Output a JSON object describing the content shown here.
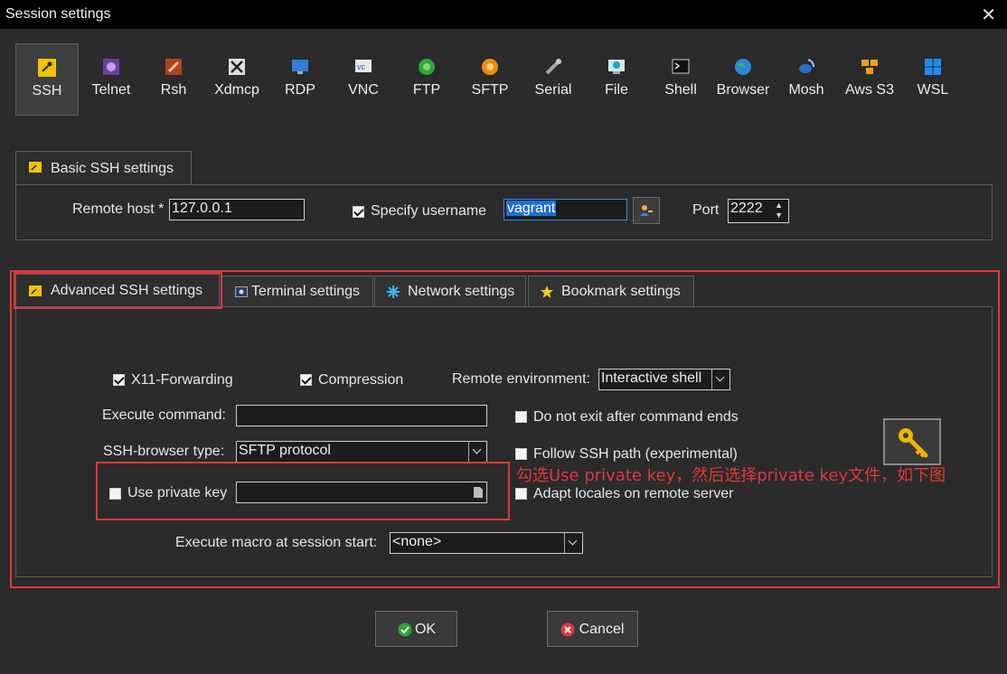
{
  "window": {
    "title": "Session settings",
    "close_glyph": "✕"
  },
  "protocols": [
    {
      "label": "SSH",
      "icon": "key-icon",
      "selected": true
    },
    {
      "label": "Telnet",
      "icon": "telnet-icon"
    },
    {
      "label": "Rsh",
      "icon": "rsh-icon"
    },
    {
      "label": "Xdmcp",
      "icon": "xdmcp-icon"
    },
    {
      "label": "RDP",
      "icon": "rdp-icon"
    },
    {
      "label": "VNC",
      "icon": "vnc-icon"
    },
    {
      "label": "FTP",
      "icon": "ftp-icon"
    },
    {
      "label": "SFTP",
      "icon": "sftp-icon"
    },
    {
      "label": "Serial",
      "icon": "serial-icon"
    },
    {
      "label": "File",
      "icon": "file-icon"
    },
    {
      "label": "Shell",
      "icon": "shell-icon"
    },
    {
      "label": "Browser",
      "icon": "browser-icon"
    },
    {
      "label": "Mosh",
      "icon": "mosh-icon"
    },
    {
      "label": "Aws S3",
      "icon": "aws-s3-icon"
    },
    {
      "label": "WSL",
      "icon": "wsl-icon"
    }
  ],
  "basic": {
    "tab_label": "Basic SSH settings",
    "remote_host_label": "Remote host *",
    "remote_host_value": "127.0.0.1",
    "specify_username_label": "Specify username",
    "specify_username_checked": true,
    "username_value": "vagrant",
    "port_label": "Port",
    "port_value": "2222"
  },
  "tabs": [
    {
      "label": "Advanced SSH settings",
      "icon": "key-icon"
    },
    {
      "label": "Terminal settings",
      "icon": "terminal-icon"
    },
    {
      "label": "Network settings",
      "icon": "network-icon"
    },
    {
      "label": "Bookmark settings",
      "icon": "star-icon"
    }
  ],
  "advanced": {
    "x11_label": "X11-Forwarding",
    "compression_label": "Compression",
    "remote_env_label": "Remote environment:",
    "remote_env_value": "Interactive shell",
    "execute_command_label": "Execute command:",
    "execute_command_value": "",
    "do_not_exit_label": "Do not exit after command ends",
    "ssh_browser_label": "SSH-browser type:",
    "ssh_browser_value": "SFTP protocol",
    "follow_ssh_label": "Follow SSH path (experimental)",
    "use_private_key_label": "Use private key",
    "private_key_value": "",
    "adapt_locales_label": "Adapt locales on remote server",
    "macro_label": "Execute macro at session start:",
    "macro_value": "<none>"
  },
  "annotation": {
    "text": "勾选Use private key，然后选择private key文件，如下图",
    "color": "#e0383b"
  },
  "buttons": {
    "ok_label": "OK",
    "cancel_label": "Cancel"
  },
  "colors": {
    "accent_red": "#e0383b",
    "key_yellow": "#f2b400"
  }
}
